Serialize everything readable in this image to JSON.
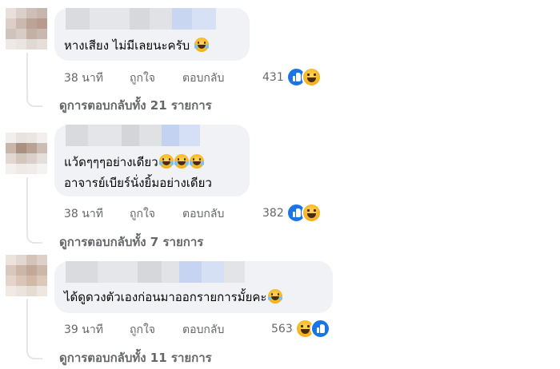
{
  "comments": [
    {
      "lines": [
        "หางเสียง ไม่มีเลยนะครับ"
      ],
      "time": "38 นาที",
      "like_label": "ถูกใจ",
      "reply_label": "ตอบกลับ",
      "reaction_count": "431",
      "reaction_icons": [
        "like-icon",
        "haha-icon"
      ],
      "view_replies": "ดูการตอบกลับทั้ง 21 รายการ"
    },
    {
      "lines": [
        "แว้ดๆๆๆอย่างเดียว",
        "อาจารย์เบียร์นั่งยิ้มอย่างเดียว"
      ],
      "time": "38 นาที",
      "like_label": "ถูกใจ",
      "reply_label": "ตอบกลับ",
      "reaction_count": "382",
      "reaction_icons": [
        "like-icon",
        "haha-icon"
      ],
      "view_replies": "ดูการตอบกลับทั้ง 7 รายการ"
    },
    {
      "lines": [
        "ได้ดูดวงตัวเองก่อนมาออกรายการมั้ยคะ"
      ],
      "time": "39 นาที",
      "like_label": "ถูกใจ",
      "reply_label": "ตอบกลับ",
      "reaction_count": "563",
      "reaction_icons": [
        "haha-icon",
        "like-icon"
      ],
      "view_replies": "ดูการตอบกลับทั้ง 11 รายการ"
    }
  ],
  "colors": {
    "bubble_bg": "#f0f2f5",
    "meta_text": "#65676b",
    "like_blue": "#1b74e4",
    "haha_yellow": "#f5b018"
  }
}
